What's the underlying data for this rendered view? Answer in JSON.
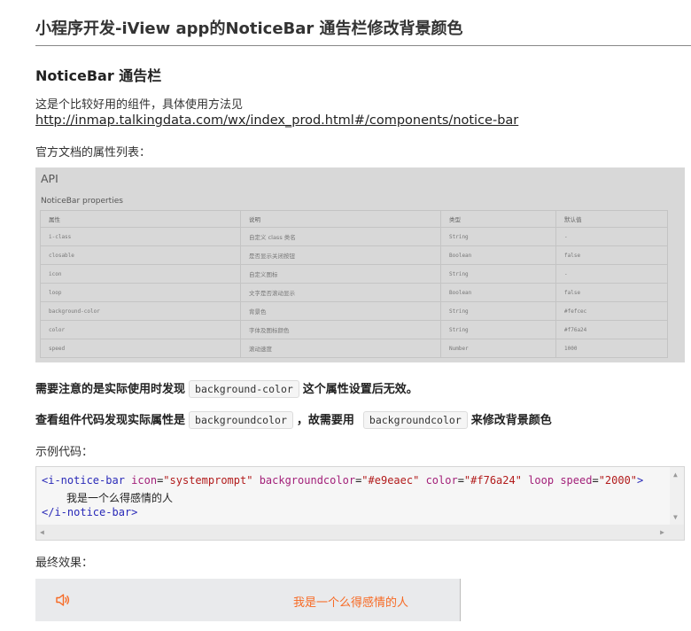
{
  "title": "小程序开发-iView app的NoticeBar 通告栏修改背景颜色",
  "section_heading": "NoticeBar 通告栏",
  "intro_text": "这是个比较好用的组件，具体使用方法见",
  "doc_link": "http://inmap.talkingdata.com/wx/index_prod.html#/components/notice-bar",
  "props_caption": "官方文档的属性列表：",
  "api_image": {
    "title": "API",
    "subtitle": "NoticeBar properties",
    "headers": [
      "属性",
      "说明",
      "类型",
      "默认值"
    ],
    "rows": [
      [
        "i-class",
        "自定义 class 类名",
        "String",
        "-"
      ],
      [
        "closable",
        "是否显示关闭按钮",
        "Boolean",
        "false"
      ],
      [
        "icon",
        "自定义图标",
        "String",
        "-"
      ],
      [
        "loop",
        "文字是否滚动显示",
        "Boolean",
        "false"
      ],
      [
        "background-color",
        "背景色",
        "String",
        "#fefcec"
      ],
      [
        "color",
        "字体及图标颜色",
        "String",
        "#f76a24"
      ],
      [
        "speed",
        "滚动速度",
        "Number",
        "1000"
      ]
    ]
  },
  "note1": {
    "before": "需要注意的是实际使用时发现",
    "code": "background-color",
    "after": "这个属性设置后无效。"
  },
  "note2": {
    "before": "查看组件代码发现实际属性是",
    "code1": "backgroundcolor",
    "middle": "，故需要用",
    "code2": "backgroundcolor",
    "after": "来修改背景颜色"
  },
  "example_caption": "示例代码：",
  "code": {
    "open_tag": "<i-notice-bar",
    "attr_icon": "icon",
    "val_icon": "\"systemprompt\"",
    "attr_bg": "backgroundcolor",
    "val_bg": "\"#e9eaec\"",
    "attr_color": "color",
    "val_color": "\"#f76a24\"",
    "attr_loop": "loop",
    "attr_speed": "speed",
    "val_speed": "\"2000\"",
    "open_end": ">",
    "inner_text": "我是一个么得感情的人",
    "close_tag": "</i-notice-bar>"
  },
  "result_caption": "最终效果：",
  "result": {
    "text": "我是一个么得感情的人",
    "background": "#e9eaec",
    "color": "#f76a24",
    "icon": "speaker-icon"
  }
}
